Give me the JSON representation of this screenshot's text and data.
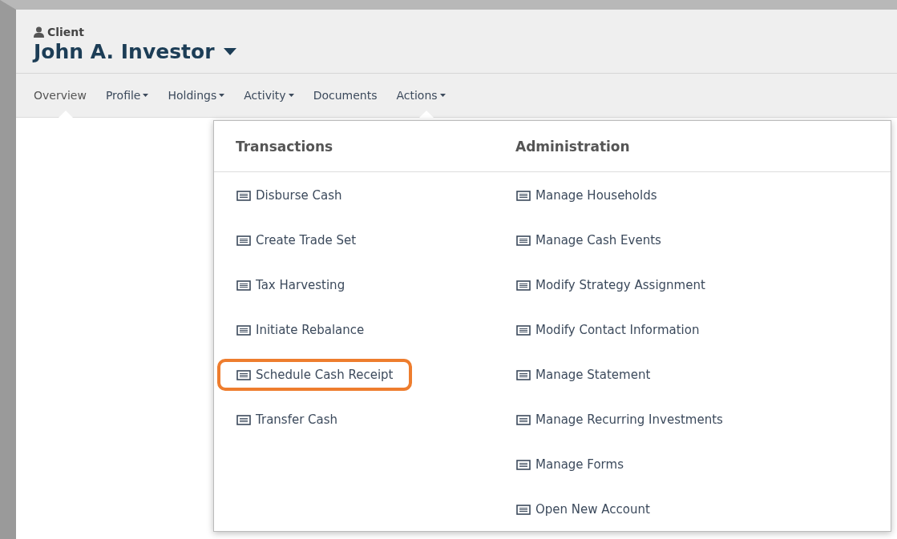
{
  "client": {
    "label": "Client",
    "name": "John A. Investor"
  },
  "tabs": [
    {
      "label": "Overview",
      "selected": true,
      "dropdown": false,
      "open": false
    },
    {
      "label": "Profile",
      "selected": false,
      "dropdown": true,
      "open": false
    },
    {
      "label": "Holdings",
      "selected": false,
      "dropdown": true,
      "open": false
    },
    {
      "label": "Activity",
      "selected": false,
      "dropdown": true,
      "open": false
    },
    {
      "label": "Documents",
      "selected": false,
      "dropdown": false,
      "open": false
    },
    {
      "label": "Actions",
      "selected": false,
      "dropdown": true,
      "open": true
    }
  ],
  "menu": {
    "columns": [
      {
        "heading": "Transactions",
        "items": [
          {
            "label": "Disburse Cash",
            "highlighted": false
          },
          {
            "label": "Create Trade Set",
            "highlighted": false
          },
          {
            "label": "Tax Harvesting",
            "highlighted": false
          },
          {
            "label": "Initiate Rebalance",
            "highlighted": false
          },
          {
            "label": "Schedule Cash Receipt",
            "highlighted": true
          },
          {
            "label": "Transfer Cash",
            "highlighted": false
          }
        ]
      },
      {
        "heading": "Administration",
        "items": [
          {
            "label": "Manage Households",
            "highlighted": false
          },
          {
            "label": "Manage Cash Events",
            "highlighted": false
          },
          {
            "label": "Modify Strategy Assignment",
            "highlighted": false
          },
          {
            "label": "Modify Contact Information",
            "highlighted": false
          },
          {
            "label": "Manage Statement",
            "highlighted": false
          },
          {
            "label": "Manage Recurring Investments",
            "highlighted": false
          },
          {
            "label": "Manage Forms",
            "highlighted": false
          },
          {
            "label": "Open New Account",
            "highlighted": false
          }
        ]
      }
    ]
  }
}
